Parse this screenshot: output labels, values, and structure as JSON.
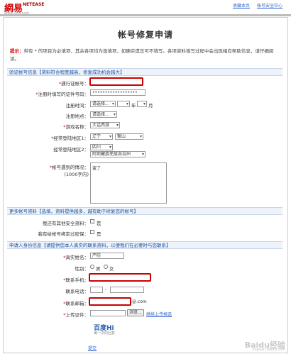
{
  "header": {
    "logo_cn": "網易",
    "logo_en": "NETEASE",
    "logo_url": "www.163.com",
    "links": [
      "收藏本页",
      "帐号安全中心"
    ]
  },
  "page": {
    "title": "帐号修复申请",
    "notice_label": "提示：",
    "notice_text": "带有 * 的项目为必填项，其余各项均为选填项，如确实遗忘可不填写。各项资料填写过程中会出现相应帮助信息，请仔细阅读。"
  },
  "section1": {
    "header": "验证帐号信息【资料符合程度越高，修复成功机会越大】",
    "fields": {
      "account": {
        "label": "通行证帐号：",
        "value": ""
      },
      "id_number": {
        "label": "注册时填写的证件号码：",
        "value": "••••••••••••••••••"
      },
      "reg_time": {
        "label": "注册时间：",
        "year": "请选择...",
        "month": "年",
        "day": "月"
      },
      "reg_place": {
        "label": "注册地点：",
        "value": "请选择..."
      },
      "game": {
        "label": "游戏名称：",
        "value": "大话西游"
      },
      "region1": {
        "label": "经常登陆地区1：",
        "province": "辽宁",
        "city": "鞍山"
      },
      "region2": {
        "label": "经常登陆地区2：",
        "province": "四川",
        "city": "阿坝藏族羌族自治州"
      },
      "situation": {
        "label": "帐号遇到的情况：",
        "label2": "(1000字内)",
        "value": "盗了"
      }
    }
  },
  "section2": {
    "header": "更多帐号资料【选填，资料提供越多，越有助于修复您的帐号】",
    "q1": {
      "label": "我还有其他安全资料：",
      "option": "是"
    },
    "q2": {
      "label": "我有给帐号绑定过密保：",
      "option": "是"
    }
  },
  "section3": {
    "header": "申请人身份信息【请提供您本人真实的联系资料，以便我们在必要时与您联系】",
    "name": {
      "label": "真实姓名：",
      "value": "严防"
    },
    "gender": {
      "label": "性别：",
      "male": "男",
      "female": "女"
    },
    "mobile": {
      "label": "联系手机：",
      "value": ""
    },
    "phone": {
      "label": "联系电话：",
      "sep": "-"
    },
    "email": {
      "label": "联系邮箱：",
      "suffix": "@.com"
    },
    "upload": {
      "label": "上传证件：",
      "browse": "浏览...",
      "add": "继续上传候选"
    },
    "submit_label": "提交"
  },
  "watermark": {
    "hi_logo": "百度Hi",
    "hi_sub": "每一次的回复",
    "baidu": "Baidu经验",
    "baidu_sub": "jingyan.baidu.com"
  },
  "colors": {
    "accent": "#d40000",
    "link": "#3366cc",
    "section_bg": "#eef3fa"
  }
}
